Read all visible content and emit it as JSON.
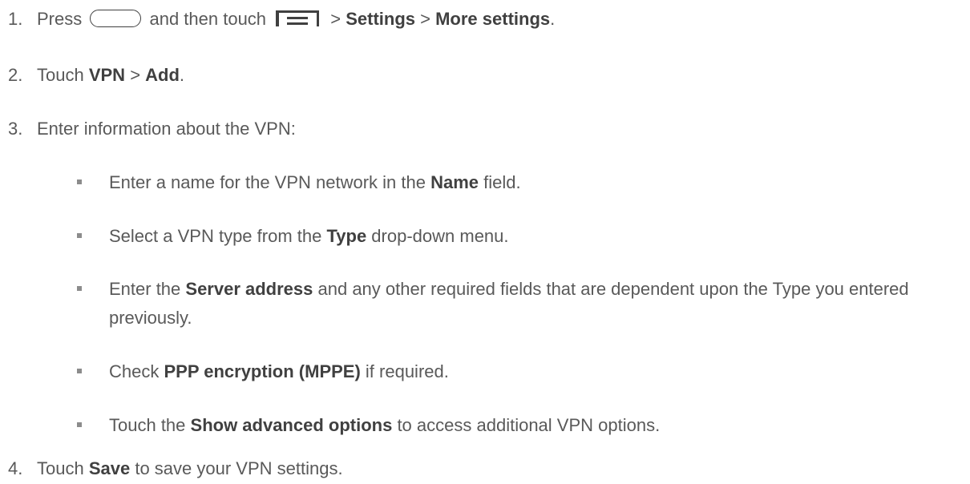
{
  "steps": [
    {
      "num": "1.",
      "parts": {
        "a": "Press ",
        "b": " and then touch ",
        "c": " > ",
        "settings": "Settings",
        "d": " > ",
        "more_settings": "More settings",
        "e": "."
      },
      "icons": [
        "home-key-icon",
        "menu-key-icon"
      ]
    },
    {
      "num": "2.",
      "parts": {
        "a": "Touch ",
        "vpn": "VPN",
        "b": " > ",
        "add": "Add",
        "c": "."
      }
    },
    {
      "num": "3.",
      "text": "Enter information about the VPN:",
      "bullets": [
        {
          "a": "Enter a name for the VPN network in the ",
          "bold": "Name",
          "b": " field."
        },
        {
          "a": "Select a VPN type from the ",
          "bold": "Type",
          "b": " drop-down menu."
        },
        {
          "a": "Enter the ",
          "bold": "Server address",
          "b": " and any other required fields that are dependent upon the Type you entered previously."
        },
        {
          "a": "Check ",
          "bold": "PPP encryption (MPPE)",
          "b": " if required."
        },
        {
          "a": "Touch the ",
          "bold": "Show advanced options",
          "b": " to access additional VPN options."
        }
      ]
    },
    {
      "num": "4.",
      "parts": {
        "a": "Touch ",
        "save": "Save",
        "b": " to save your VPN settings."
      }
    }
  ],
  "colors": {
    "text": "#595959",
    "bold": "#404040",
    "bullet": "#8c8c8c"
  }
}
